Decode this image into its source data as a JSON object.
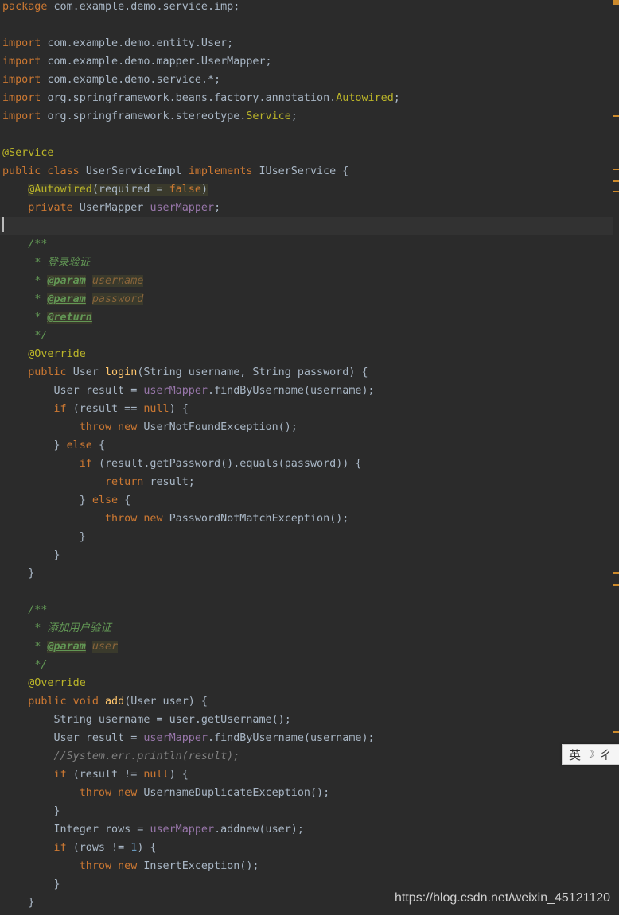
{
  "editor": {
    "lines": [
      [
        [
          "kw",
          "package "
        ],
        [
          "",
          "com.example.demo.service.imp;"
        ]
      ],
      [],
      [
        [
          "kw",
          "import "
        ],
        [
          "",
          "com.example.demo.entity.User;"
        ]
      ],
      [
        [
          "kw",
          "import "
        ],
        [
          "",
          "com.example.demo.mapper.UserMapper;"
        ]
      ],
      [
        [
          "kw",
          "import "
        ],
        [
          "",
          "com.example.demo.service.*;"
        ]
      ],
      [
        [
          "kw",
          "import "
        ],
        [
          "",
          "org.springframework.beans.factory.annotation."
        ],
        [
          "ann",
          "Autowired"
        ],
        [
          "",
          ";"
        ]
      ],
      [
        [
          "kw",
          "import "
        ],
        [
          "",
          "org.springframework.stereotype."
        ],
        [
          "ann",
          "Service"
        ],
        [
          "",
          ";"
        ]
      ],
      [],
      [
        [
          "ann",
          "@Service"
        ]
      ],
      [
        [
          "kw",
          "public class "
        ],
        [
          "",
          "UserServiceImpl "
        ],
        [
          "kw",
          "implements "
        ],
        [
          "",
          "IUserService {"
        ]
      ],
      [
        [
          "",
          "    "
        ],
        [
          "ann ann-bg",
          "@Autowired"
        ],
        [
          "ann-bg",
          "(required = "
        ],
        [
          "kw ann-bg",
          "false"
        ],
        [
          "ann-bg",
          ")"
        ]
      ],
      [
        [
          "",
          "    "
        ],
        [
          "kw",
          "private "
        ],
        [
          "",
          "UserMapper "
        ],
        [
          "fld",
          "userMapper"
        ],
        [
          "",
          ";"
        ]
      ],
      [],
      [
        [
          "",
          "    "
        ],
        [
          "doc",
          "/**"
        ]
      ],
      [
        [
          "",
          "     "
        ],
        [
          "doc",
          "* 登录验证"
        ]
      ],
      [
        [
          "",
          "     "
        ],
        [
          "doc",
          "* "
        ],
        [
          "doctag",
          "@param"
        ],
        [
          "doc",
          " "
        ],
        [
          "docparam",
          "username"
        ]
      ],
      [
        [
          "",
          "     "
        ],
        [
          "doc",
          "* "
        ],
        [
          "doctag",
          "@param"
        ],
        [
          "doc",
          " "
        ],
        [
          "docparam",
          "password"
        ]
      ],
      [
        [
          "",
          "     "
        ],
        [
          "doc",
          "* "
        ],
        [
          "doctag",
          "@return"
        ]
      ],
      [
        [
          "",
          "     "
        ],
        [
          "doc",
          "*/"
        ]
      ],
      [
        [
          "",
          "    "
        ],
        [
          "ann",
          "@Override"
        ]
      ],
      [
        [
          "",
          "    "
        ],
        [
          "kw",
          "public "
        ],
        [
          "",
          "User "
        ],
        [
          "fn",
          "login"
        ],
        [
          "",
          "(String username, String password) {"
        ]
      ],
      [
        [
          "",
          "        "
        ],
        [
          "",
          "User result = "
        ],
        [
          "fld",
          "userMapper"
        ],
        [
          "",
          ".findByUsername(username);"
        ]
      ],
      [
        [
          "",
          "        "
        ],
        [
          "kw",
          "if "
        ],
        [
          "",
          "(result == "
        ],
        [
          "kw",
          "null"
        ],
        [
          "",
          ") {"
        ]
      ],
      [
        [
          "",
          "            "
        ],
        [
          "kw",
          "throw new "
        ],
        [
          "",
          "UserNotFoundException();"
        ]
      ],
      [
        [
          "",
          "        "
        ],
        [
          "",
          "} "
        ],
        [
          "kw",
          "else "
        ],
        [
          "",
          "{"
        ]
      ],
      [
        [
          "",
          "            "
        ],
        [
          "kw",
          "if "
        ],
        [
          "",
          "(result.getPassword().equals(password)) {"
        ]
      ],
      [
        [
          "",
          "                "
        ],
        [
          "kw",
          "return "
        ],
        [
          "",
          "result;"
        ]
      ],
      [
        [
          "",
          "            "
        ],
        [
          "",
          "} "
        ],
        [
          "kw",
          "else "
        ],
        [
          "",
          "{"
        ]
      ],
      [
        [
          "",
          "                "
        ],
        [
          "kw",
          "throw new "
        ],
        [
          "",
          "PasswordNotMatchException();"
        ]
      ],
      [
        [
          "",
          "            "
        ],
        [
          "",
          "}"
        ]
      ],
      [
        [
          "",
          "        "
        ],
        [
          "",
          "}"
        ]
      ],
      [
        [
          "",
          "    "
        ],
        [
          "",
          "}"
        ]
      ],
      [],
      [
        [
          "",
          "    "
        ],
        [
          "doc",
          "/**"
        ]
      ],
      [
        [
          "",
          "     "
        ],
        [
          "doc",
          "* 添加用户验证"
        ]
      ],
      [
        [
          "",
          "     "
        ],
        [
          "doc",
          "* "
        ],
        [
          "doctag",
          "@param"
        ],
        [
          "doc",
          " "
        ],
        [
          "docparam",
          "user"
        ]
      ],
      [
        [
          "",
          "     "
        ],
        [
          "doc",
          "*/"
        ]
      ],
      [
        [
          "",
          "    "
        ],
        [
          "ann",
          "@Override"
        ]
      ],
      [
        [
          "",
          "    "
        ],
        [
          "kw",
          "public void "
        ],
        [
          "fn",
          "add"
        ],
        [
          "",
          "(User user) {"
        ]
      ],
      [
        [
          "",
          "        "
        ],
        [
          "",
          "String username = user.getUsername();"
        ]
      ],
      [
        [
          "",
          "        "
        ],
        [
          "",
          "User result = "
        ],
        [
          "fld",
          "userMapper"
        ],
        [
          "",
          ".findByUsername(username);"
        ]
      ],
      [
        [
          "",
          "        "
        ],
        [
          "cmt",
          "//System.err.println(result);"
        ]
      ],
      [
        [
          "",
          "        "
        ],
        [
          "kw",
          "if "
        ],
        [
          "",
          "(result != "
        ],
        [
          "kw",
          "null"
        ],
        [
          "",
          ") {"
        ]
      ],
      [
        [
          "",
          "            "
        ],
        [
          "kw",
          "throw new "
        ],
        [
          "",
          "UsernameDuplicateException();"
        ]
      ],
      [
        [
          "",
          "        "
        ],
        [
          "",
          "}"
        ]
      ],
      [
        [
          "",
          "        "
        ],
        [
          "",
          "Integer rows = "
        ],
        [
          "fld",
          "userMapper"
        ],
        [
          "",
          ".addnew(user);"
        ]
      ],
      [
        [
          "",
          "        "
        ],
        [
          "kw",
          "if "
        ],
        [
          "",
          "(rows != "
        ],
        [
          "num",
          "1"
        ],
        [
          "",
          ") {"
        ]
      ],
      [
        [
          "",
          "            "
        ],
        [
          "kw",
          "throw new "
        ],
        [
          "",
          "InsertException();"
        ]
      ],
      [
        [
          "",
          "        "
        ],
        [
          "",
          "}"
        ]
      ],
      [
        [
          "",
          "    "
        ],
        [
          "",
          "}"
        ]
      ]
    ],
    "current_line": 12
  },
  "ime": {
    "mode_label": "英",
    "moon_icon": "moon-icon",
    "extra": "ㄔ"
  },
  "watermark": "https://blog.csdn.net/weixin_45121120",
  "colors": {
    "background": "#2b2b2b",
    "keyword": "#cc7832",
    "annotation": "#bbb529",
    "field": "#9876aa",
    "method_decl": "#ffc66d",
    "number": "#6897bb",
    "javadoc": "#629755",
    "comment": "#808080"
  }
}
